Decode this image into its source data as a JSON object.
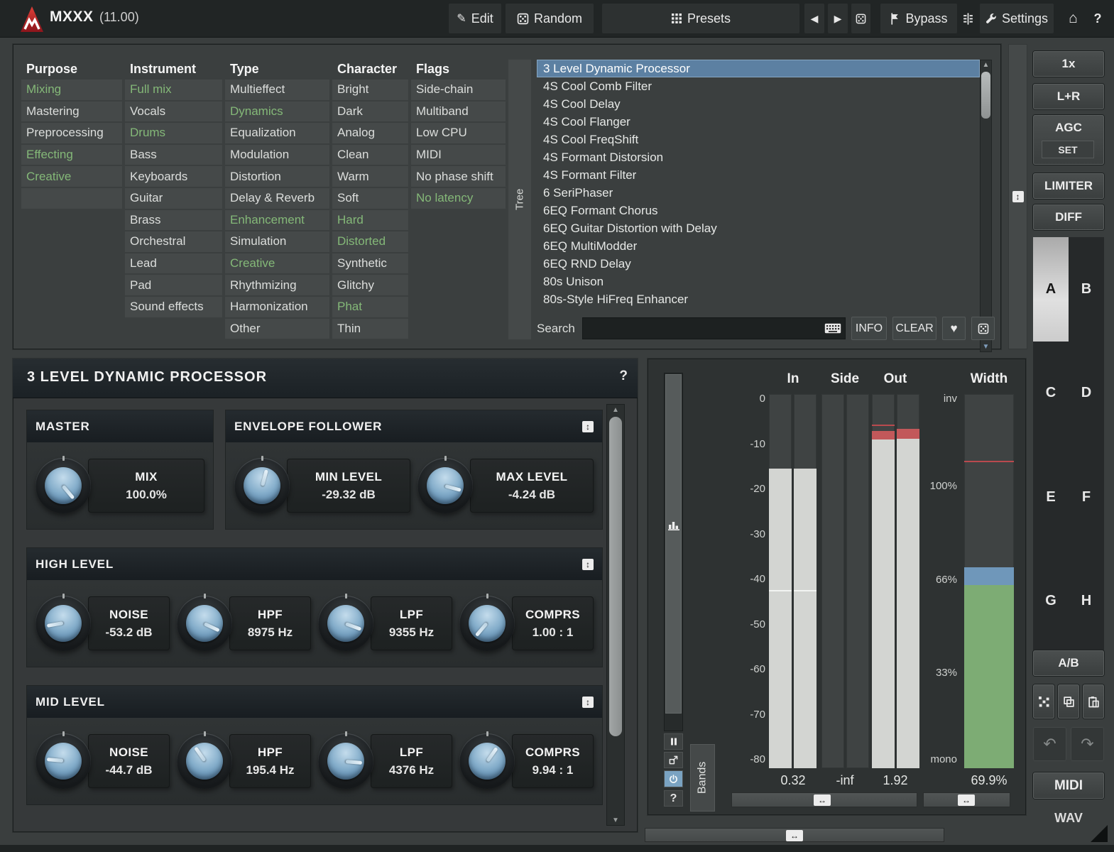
{
  "titlebar": {
    "app_name": "MXXX",
    "version": "(11.00)",
    "edit": "Edit",
    "random": "Random",
    "presets": "Presets",
    "bypass": "Bypass",
    "settings": "Settings",
    "help": "?"
  },
  "browser": {
    "tree_label": "Tree",
    "columns": [
      {
        "header": "Purpose",
        "items": [
          {
            "label": "Mixing",
            "on": true
          },
          {
            "label": "Mastering",
            "on": false
          },
          {
            "label": "Preprocessing",
            "on": false
          },
          {
            "label": "Effecting",
            "on": true
          },
          {
            "label": "Creative",
            "on": true
          },
          {
            "label": "",
            "on": false
          }
        ]
      },
      {
        "header": "Instrument",
        "items": [
          {
            "label": "Full mix",
            "on": true
          },
          {
            "label": "Vocals",
            "on": false
          },
          {
            "label": "Drums",
            "on": true
          },
          {
            "label": "Bass",
            "on": false
          },
          {
            "label": "Keyboards",
            "on": false
          },
          {
            "label": "Guitar",
            "on": false
          },
          {
            "label": "Brass",
            "on": false
          },
          {
            "label": "Orchestral",
            "on": false
          },
          {
            "label": "Lead",
            "on": false
          },
          {
            "label": "Pad",
            "on": false
          },
          {
            "label": "Sound effects",
            "on": false
          }
        ]
      },
      {
        "header": "Type",
        "items": [
          {
            "label": "Multieffect",
            "on": false
          },
          {
            "label": "Dynamics",
            "on": true
          },
          {
            "label": "Equalization",
            "on": false
          },
          {
            "label": "Modulation",
            "on": false
          },
          {
            "label": "Distortion",
            "on": false
          },
          {
            "label": "Delay & Reverb",
            "on": false
          },
          {
            "label": "Enhancement",
            "on": true
          },
          {
            "label": "Simulation",
            "on": false
          },
          {
            "label": "Creative",
            "on": true
          },
          {
            "label": "Rhythmizing",
            "on": false
          },
          {
            "label": "Harmonization",
            "on": false
          },
          {
            "label": "Other",
            "on": false
          }
        ]
      },
      {
        "header": "Character",
        "items": [
          {
            "label": "Bright",
            "on": false
          },
          {
            "label": "Dark",
            "on": false
          },
          {
            "label": "Analog",
            "on": false
          },
          {
            "label": "Clean",
            "on": false
          },
          {
            "label": "Warm",
            "on": false
          },
          {
            "label": "Soft",
            "on": false
          },
          {
            "label": "Hard",
            "on": true
          },
          {
            "label": "Distorted",
            "on": true
          },
          {
            "label": "Synthetic",
            "on": false
          },
          {
            "label": "Glitchy",
            "on": false
          },
          {
            "label": "Phat",
            "on": true
          },
          {
            "label": "Thin",
            "on": false
          }
        ]
      },
      {
        "header": "Flags",
        "items": [
          {
            "label": "Side-chain",
            "on": false
          },
          {
            "label": "Multiband",
            "on": false
          },
          {
            "label": "Low CPU",
            "on": false
          },
          {
            "label": "MIDI",
            "on": false
          },
          {
            "label": "No phase shift",
            "on": false
          },
          {
            "label": "No latency",
            "on": true
          }
        ]
      }
    ],
    "presets": [
      "3 Level Dynamic Processor",
      "4S Cool Comb Filter",
      "4S Cool Delay",
      "4S Cool Flanger",
      "4S Cool FreqShift",
      "4S Formant Distorsion",
      "4S Formant Filter",
      "6 SeriPhaser",
      "6EQ Formant Chorus",
      "6EQ Guitar Distortion with Delay",
      "6EQ MultiModder",
      "6EQ RND Delay",
      "80s Unison",
      "80s-Style HiFreq Enhancer"
    ],
    "selected_index": 0,
    "search_label": "Search",
    "search_value": "",
    "info_button": "INFO",
    "clear_button": "CLEAR"
  },
  "sidebar": {
    "zoom_button": "1x",
    "channels_button": "L+R",
    "agc_button": "AGC",
    "set_button": "SET",
    "limiter_button": "LIMITER",
    "diff_button": "DIFF",
    "morph_slots": [
      "A",
      "B",
      "C",
      "D",
      "E",
      "F",
      "G",
      "H"
    ],
    "active_slot": "A",
    "ab_button": "A/B",
    "midi_button": "MIDI",
    "wav_label": "WAV"
  },
  "device": {
    "title": "3 LEVEL DYNAMIC PROCESSOR",
    "help": "?",
    "sections": [
      {
        "name": "MASTER",
        "collapse_icon": false,
        "params": [
          {
            "label": "MIX",
            "value": "100.0%",
            "angle": 140
          }
        ]
      },
      {
        "name": "ENVELOPE FOLLOWER",
        "collapse_icon": true,
        "params": [
          {
            "label": "MIN LEVEL",
            "value": "-29.32 dB",
            "angle": 15
          },
          {
            "label": "MAX LEVEL",
            "value": "-4.24 dB",
            "angle": 105
          }
        ]
      },
      {
        "name": "HIGH LEVEL",
        "collapse_icon": true,
        "params": [
          {
            "label": "NOISE",
            "value": "-53.2 dB",
            "angle": -100
          },
          {
            "label": "HPF",
            "value": "8975 Hz",
            "angle": 115
          },
          {
            "label": "LPF",
            "value": "9355 Hz",
            "angle": 110
          },
          {
            "label": "COMPRS",
            "value": "1.00 : 1",
            "angle": -140
          }
        ]
      },
      {
        "name": "MID LEVEL",
        "collapse_icon": true,
        "params": [
          {
            "label": "NOISE",
            "value": "-44.7 dB",
            "angle": -85
          },
          {
            "label": "HPF",
            "value": "195.4 Hz",
            "angle": -35
          },
          {
            "label": "LPF",
            "value": "4376 Hz",
            "angle": 95
          },
          {
            "label": "COMPRS",
            "value": "9.94 : 1",
            "angle": 35
          }
        ]
      }
    ]
  },
  "meters": {
    "bands_label": "Bands",
    "columns": [
      {
        "label": "In",
        "value": "0.32"
      },
      {
        "label": "Side",
        "value": "-inf"
      },
      {
        "label": "Out",
        "value": "1.92"
      },
      {
        "label": "Width",
        "value": "69.9%"
      }
    ],
    "db_scale": [
      "0",
      "-10",
      "-20",
      "-30",
      "-40",
      "-50",
      "-60",
      "-70",
      "-80"
    ],
    "width_scale": [
      "inv",
      "100%",
      "66%",
      "33%",
      "mono"
    ],
    "readings": {
      "in_db": [
        -15.5,
        -15.5
      ],
      "in_avg_db": -42.3,
      "out_bars": [
        {
          "fill_db": -9.0,
          "cap_db": -7.1,
          "peak_db": -5.7
        },
        {
          "fill_db": -8.8,
          "cap_db": -6.6,
          "peak_db": null
        }
      ],
      "width_green_top_pct": 64,
      "width_blue_top_pct": 70.4,
      "width_peak_pct": 109.4
    }
  },
  "icons": {
    "edit": "pencil",
    "random": "dice",
    "presets": "grid",
    "prev": "left-arrow",
    "next": "right-arrow",
    "bypass": "flag",
    "settings": "wrench",
    "home": "house",
    "search": "keyboard",
    "favorite": "heart",
    "collapse": "up-down-arrow",
    "resize_handle": "left-right-arrow",
    "undo": "curved-left-arrow",
    "redo": "curved-right-arrow"
  }
}
